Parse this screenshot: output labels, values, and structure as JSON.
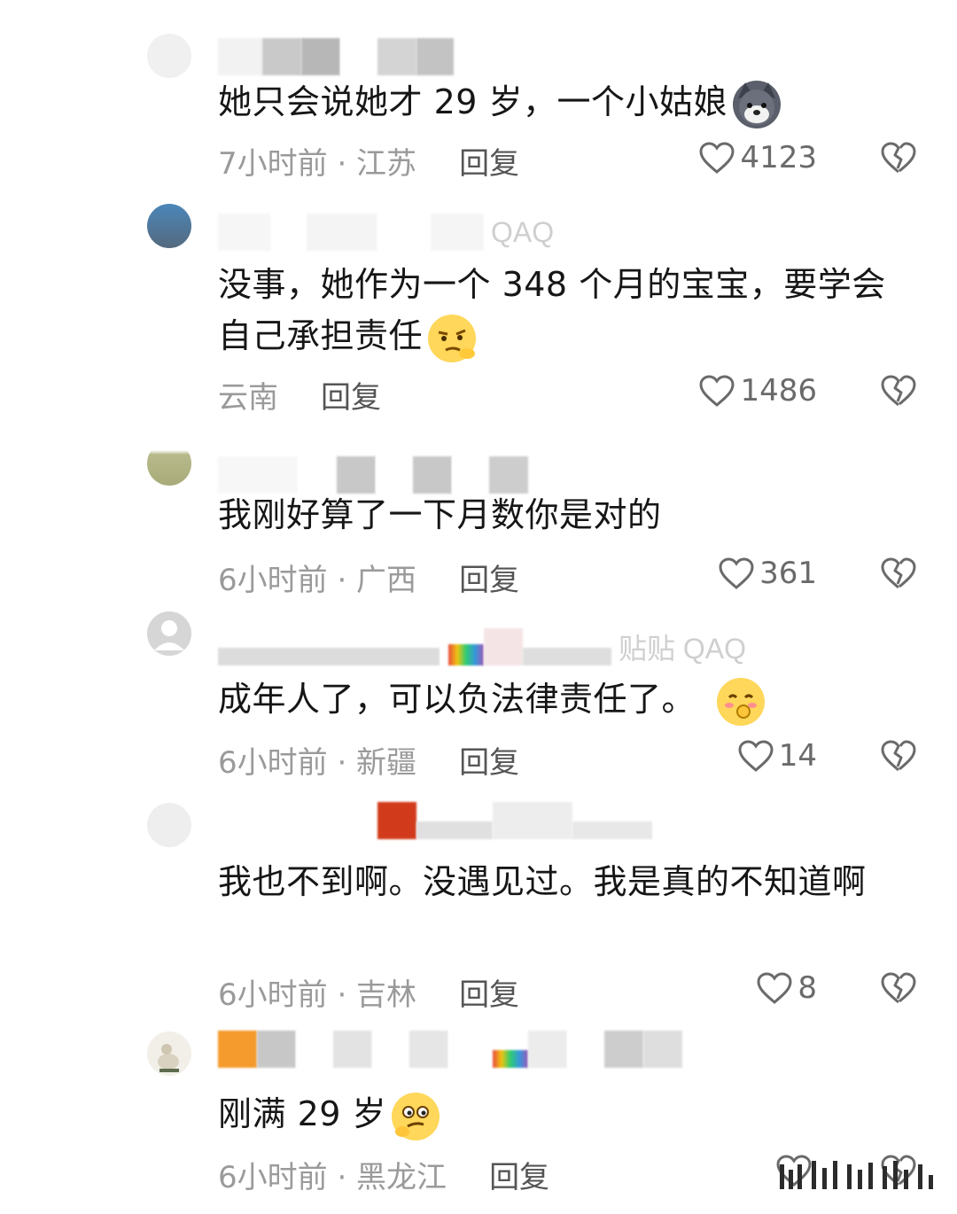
{
  "comments": [
    {
      "username_suffix": "",
      "text": "她只会说她才 29 岁，一个小姑娘",
      "meta": "7小时前 · 江苏",
      "reply_label": "回复",
      "likes": "4123",
      "emoji": "dog-face-icon"
    },
    {
      "username_suffix": "QAQ",
      "text": "没事，她作为一个 348 个月的宝宝，要学会自己承担责任",
      "meta": "云南",
      "reply_label": "回复",
      "likes": "1486",
      "emoji": "smug-face-icon"
    },
    {
      "username_suffix": "",
      "text": "我刚好算了一下月数你是对的",
      "meta": "6小时前 · 广西",
      "reply_label": "回复",
      "likes": "361",
      "emoji": ""
    },
    {
      "username_suffix": "贴贴 QAQ",
      "text": "成年人了，可以负法律责任了。",
      "meta": "6小时前 · 新疆",
      "reply_label": "回复",
      "likes": "14",
      "emoji": "shy-face-icon"
    },
    {
      "username_suffix": "",
      "text": "我也不到啊。没遇见过。我是真的不知道啊",
      "meta": "6小时前 · 吉林",
      "reply_label": "回复",
      "likes": "8",
      "emoji": ""
    },
    {
      "username_suffix": "",
      "text": "刚满 29 岁",
      "meta": "6小时前 · 黑龙江",
      "reply_label": "回复",
      "likes": "",
      "emoji": "thinking-face-icon"
    }
  ],
  "colors": {
    "text": "#161616",
    "meta": "#9a9a9a",
    "reply": "#555555"
  }
}
